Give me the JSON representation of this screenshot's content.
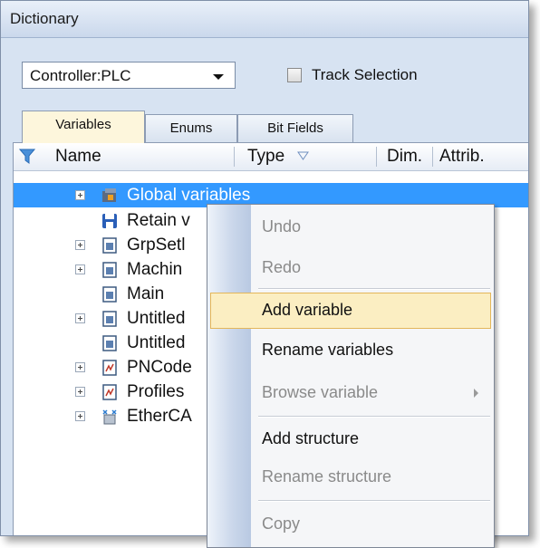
{
  "panel": {
    "title": "Dictionary"
  },
  "toolbar": {
    "controller_select": {
      "value": "Controller:PLC"
    },
    "track_selection": {
      "label": "Track Selection",
      "checked": false
    }
  },
  "tabs": [
    {
      "label": "Variables",
      "active": true
    },
    {
      "label": "Enums",
      "active": false
    },
    {
      "label": "Bit Fields",
      "active": false
    }
  ],
  "columns": [
    "Name",
    "Type",
    "Dim.",
    "Attrib."
  ],
  "rows": [
    {
      "label": "Global variables",
      "icon": "global-variables-icon",
      "expandable": true,
      "selected": true
    },
    {
      "label": "Retain v",
      "icon": "retain-icon",
      "expandable": false,
      "selected": false
    },
    {
      "label": "GrpSetl",
      "icon": "group-icon",
      "expandable": true,
      "selected": false
    },
    {
      "label": "Machin",
      "icon": "group-icon",
      "expandable": true,
      "selected": false
    },
    {
      "label": "Main",
      "icon": "group-icon",
      "expandable": false,
      "selected": false
    },
    {
      "label": "Untitled",
      "icon": "group-icon",
      "expandable": true,
      "selected": false
    },
    {
      "label": "Untitled",
      "icon": "group-icon",
      "expandable": false,
      "selected": false
    },
    {
      "label": "PNCode",
      "icon": "program-icon",
      "expandable": true,
      "selected": false
    },
    {
      "label": "Profiles",
      "icon": "program-icon",
      "expandable": true,
      "selected": false
    },
    {
      "label": "EtherCA",
      "icon": "ethercat-icon",
      "expandable": true,
      "selected": false
    }
  ],
  "context_menu": {
    "items": [
      {
        "label": "Undo",
        "enabled": false
      },
      {
        "label": "Redo",
        "enabled": false
      },
      {
        "label": "Add variable",
        "enabled": true,
        "highlighted": true
      },
      {
        "label": "Rename variables",
        "enabled": true
      },
      {
        "label": "Browse variable",
        "enabled": false,
        "submenu": true
      },
      {
        "label": "Add structure",
        "enabled": true
      },
      {
        "label": "Rename structure",
        "enabled": false
      },
      {
        "label": "Copy",
        "enabled": false
      }
    ]
  },
  "colors": {
    "selection": "#3399ff",
    "menu_highlight": "#fbeec2",
    "active_tab": "#fdf6dc",
    "panel_background": "#d7e3f2"
  }
}
